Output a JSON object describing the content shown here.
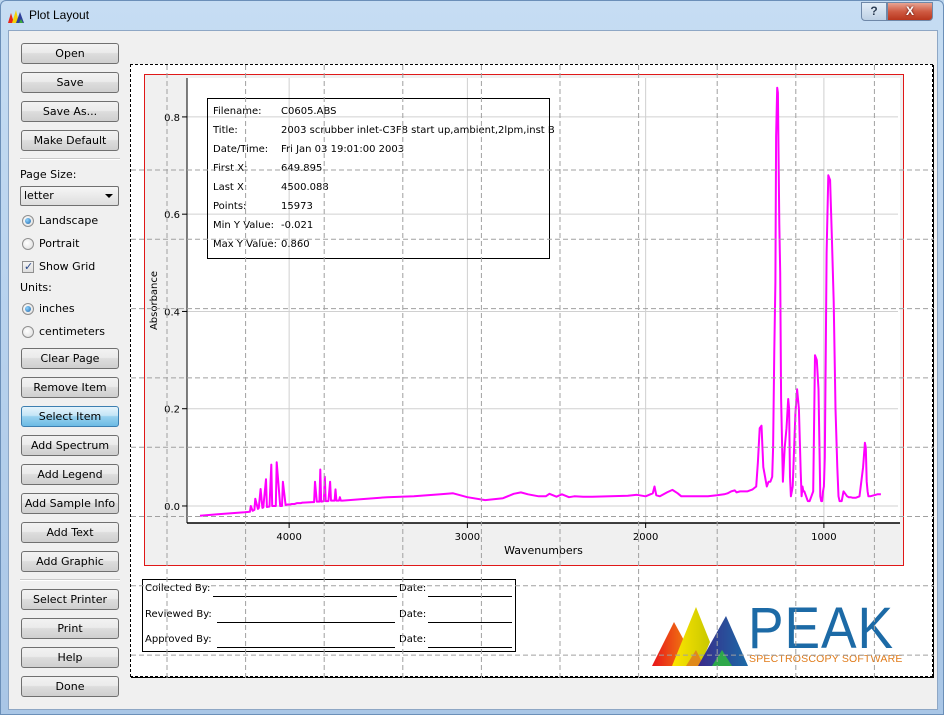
{
  "window": {
    "title": "Plot Layout",
    "help_label": "?",
    "close_label": "X"
  },
  "sidebar": {
    "top_buttons": [
      {
        "label": "Open",
        "active": true
      },
      {
        "label": "Save",
        "active": false
      },
      {
        "label": "Save As...",
        "active": false
      },
      {
        "label": "Make Default",
        "active": false
      }
    ],
    "page_size_label": "Page Size:",
    "page_size_value": "letter",
    "orientation": [
      {
        "label": "Landscape",
        "checked": true
      },
      {
        "label": "Portrait",
        "checked": false
      }
    ],
    "show_grid": {
      "label": "Show Grid",
      "checked": true
    },
    "units_label": "Units:",
    "units": [
      {
        "label": "inches",
        "checked": true
      },
      {
        "label": "centimeters",
        "checked": false
      }
    ],
    "item_buttons": [
      {
        "label": "Clear Page",
        "active": false
      },
      {
        "label": "Remove Item",
        "active": false
      },
      {
        "label": "Select Item",
        "active": true
      },
      {
        "label": "Add Spectrum",
        "active": false
      },
      {
        "label": "Add Legend",
        "active": false
      },
      {
        "label": "Add Sample Info",
        "active": false
      },
      {
        "label": "Add Text",
        "active": false
      },
      {
        "label": "Add Graphic",
        "active": false
      }
    ],
    "bottom_buttons": [
      {
        "label": "Select Printer",
        "active": false
      },
      {
        "label": "Print",
        "active": false
      },
      {
        "label": "Help",
        "active": false
      },
      {
        "label": "Done",
        "active": false
      }
    ]
  },
  "sample_info": [
    {
      "key": "Filename:",
      "value": "C0605.ABS"
    },
    {
      "key": "Title:",
      "value": "2003 scrubber inlet-C3F8 start up,ambient,2lpm,inst B"
    },
    {
      "key": "Date/Time:",
      "value": "Fri Jan 03 19:01:00 2003"
    },
    {
      "key": "First X:",
      "value": "649.895"
    },
    {
      "key": "Last X:",
      "value": "4500.088"
    },
    {
      "key": "Points:",
      "value": "15973"
    },
    {
      "key": "Min Y Value:",
      "value": "-0.021"
    },
    {
      "key": "Max Y Value:",
      "value": "0.860"
    }
  ],
  "signatures": [
    {
      "label": "Collected By:",
      "date_label": "Date:"
    },
    {
      "label": "Reviewed By:",
      "date_label": "Date:"
    },
    {
      "label": "Approved By:",
      "date_label": "Date:"
    }
  ],
  "logo": {
    "word": "PEAK",
    "subtitle": "SPECTROSCOPY SOFTWARE",
    "word_color": "#1c6aa6",
    "subtitle_color": "#e07b1a"
  },
  "colors": {
    "spectrum": "#ff00ff",
    "plot_frame": "#e01818",
    "accent_button": "#98d1ef"
  },
  "chart_data": {
    "type": "line",
    "title": "",
    "xlabel": "Wavenumbers",
    "ylabel": "Absorbance",
    "x_reversed": true,
    "xlim": [
      4573,
      573
    ],
    "ylim": [
      -0.035,
      0.88
    ],
    "x_ticks": [
      4000,
      3000,
      2000,
      1000
    ],
    "x_tick_labels": [
      "4000",
      "3000",
      "2000",
      "1000"
    ],
    "y_ticks": [
      0.0,
      0.2,
      0.4,
      0.6,
      0.8
    ],
    "y_tick_labels": [
      "0.0",
      "0.2",
      "0.4",
      "0.6",
      "0.8"
    ],
    "grid": true,
    "series": [
      {
        "name": "C0605.ABS",
        "color": "#ff00ff",
        "x": [
          4500,
          4400,
          4250,
          4220,
          4215,
          4205,
          4195,
          4190,
          4175,
          4170,
          4160,
          4150,
          4145,
          4130,
          4125,
          4110,
          4100,
          4095,
          4075,
          4070,
          4050,
          4040,
          4035,
          4020,
          4010,
          4005,
          3995,
          3985,
          3980,
          3970,
          3955,
          3950,
          3935,
          3925,
          3920,
          3870,
          3860,
          3855,
          3845,
          3830,
          3825,
          3820,
          3805,
          3800,
          3795,
          3780,
          3770,
          3765,
          3745,
          3740,
          3735,
          3720,
          3715,
          3710,
          3700,
          3600,
          3450,
          3300,
          3150,
          3080,
          3000,
          2900,
          2800,
          2740,
          2700,
          2660,
          2630,
          2600,
          2560,
          2540,
          2500,
          2470,
          2430,
          2400,
          2350,
          2300,
          2200,
          2100,
          2050,
          2000,
          1960,
          1950,
          1940,
          1920,
          1880,
          1850,
          1820,
          1800,
          1760,
          1700,
          1650,
          1600,
          1560,
          1540,
          1530,
          1520,
          1500,
          1490,
          1470,
          1430,
          1400,
          1380,
          1370,
          1360,
          1350,
          1340,
          1320,
          1310,
          1300,
          1290,
          1285,
          1278,
          1272,
          1268,
          1262,
          1258,
          1250,
          1245,
          1240,
          1230,
          1220,
          1210,
          1200,
          1195,
          1190,
          1185,
          1180,
          1175,
          1170,
          1160,
          1150,
          1140,
          1130,
          1125,
          1120,
          1115,
          1110,
          1100,
          1090,
          1080,
          1070,
          1060,
          1050,
          1040,
          1030,
          1020,
          1015,
          1010,
          1005,
          1000,
          995,
          990,
          985,
          975,
          965,
          955,
          945,
          935,
          925,
          918,
          912,
          906,
          900,
          895,
          890,
          880,
          870,
          860,
          850,
          840,
          820,
          800,
          780,
          770,
          765,
          760,
          755,
          750,
          740,
          720,
          700,
          680,
          650
        ],
        "y": [
          -0.02,
          -0.017,
          -0.013,
          -0.012,
          0.0,
          -0.01,
          -0.008,
          0.015,
          -0.006,
          -0.004,
          0.035,
          -0.004,
          -0.003,
          0.055,
          -0.002,
          -0.001,
          0.085,
          0.0,
          0.0,
          0.09,
          0.0,
          0.0,
          0.05,
          0.002,
          0.003,
          0.003,
          0.003,
          0.004,
          0.004,
          0.004,
          0.006,
          0.006,
          0.006,
          0.007,
          0.007,
          0.008,
          0.008,
          0.05,
          0.009,
          0.009,
          0.075,
          0.009,
          0.01,
          0.06,
          0.01,
          0.01,
          0.05,
          0.011,
          0.011,
          0.034,
          0.011,
          0.011,
          0.018,
          0.011,
          0.011,
          0.014,
          0.018,
          0.02,
          0.024,
          0.026,
          0.018,
          0.012,
          0.016,
          0.025,
          0.028,
          0.024,
          0.022,
          0.02,
          0.02,
          0.025,
          0.019,
          0.024,
          0.018,
          0.02,
          0.019,
          0.019,
          0.02,
          0.021,
          0.023,
          0.02,
          0.026,
          0.04,
          0.022,
          0.02,
          0.028,
          0.033,
          0.026,
          0.02,
          0.02,
          0.02,
          0.02,
          0.022,
          0.024,
          0.026,
          0.028,
          0.03,
          0.032,
          0.028,
          0.03,
          0.03,
          0.034,
          0.04,
          0.09,
          0.16,
          0.165,
          0.08,
          0.04,
          0.05,
          0.05,
          0.06,
          0.12,
          0.32,
          0.46,
          0.76,
          0.86,
          0.85,
          0.58,
          0.48,
          0.22,
          0.05,
          0.12,
          0.16,
          0.22,
          0.2,
          0.06,
          0.02,
          0.03,
          0.04,
          0.09,
          0.19,
          0.24,
          0.2,
          0.07,
          0.02,
          0.04,
          0.03,
          0.03,
          0.02,
          0.01,
          0.01,
          0.02,
          0.03,
          0.31,
          0.3,
          0.24,
          0.02,
          0.01,
          0.01,
          0.03,
          0.04,
          0.1,
          0.3,
          0.52,
          0.68,
          0.67,
          0.55,
          0.42,
          0.2,
          0.08,
          0.02,
          0.01,
          0.01,
          0.01,
          0.02,
          0.03,
          0.025,
          0.02,
          0.018,
          0.018,
          0.017,
          0.017,
          0.02,
          0.08,
          0.13,
          0.12,
          0.05,
          0.03,
          0.02,
          0.02,
          0.022,
          0.024,
          0.024
        ]
      }
    ]
  }
}
